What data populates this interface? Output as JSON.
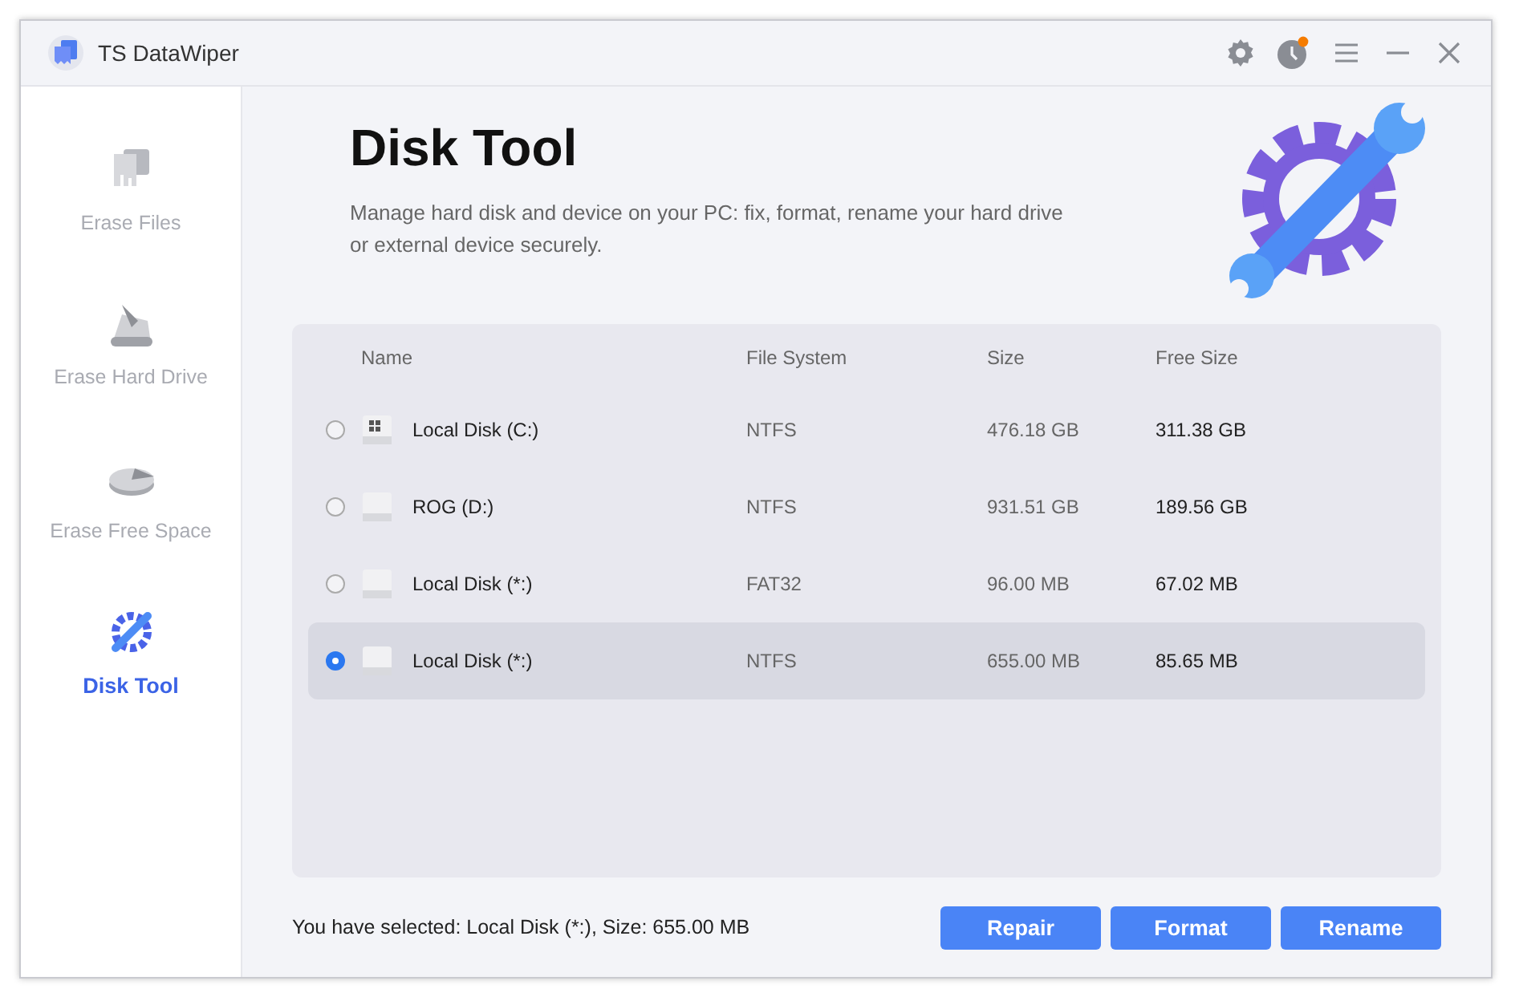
{
  "window": {
    "title": "TS DataWiper",
    "notification": true
  },
  "sidebar": {
    "items": [
      {
        "label": "Erase Files",
        "kind": "files",
        "selected": false
      },
      {
        "label": "Erase Hard Drive",
        "kind": "drive",
        "selected": false
      },
      {
        "label": "Erase Free Space",
        "kind": "space",
        "selected": false
      },
      {
        "label": "Disk Tool",
        "kind": "tool",
        "selected": true
      }
    ]
  },
  "header": {
    "title": "Disk Tool",
    "description": "Manage hard disk and device on your PC: fix, format, rename your hard drive or external device securely."
  },
  "table": {
    "columns": [
      "Name",
      "File System",
      "Size",
      "Free Size"
    ],
    "rows": [
      {
        "kind": "system",
        "name": "Local Disk (C:)",
        "file_system": "NTFS",
        "size": "476.18 GB",
        "free_size": "311.38 GB",
        "selected": false
      },
      {
        "kind": "disk",
        "name": "ROG (D:)",
        "file_system": "NTFS",
        "size": "931.51 GB",
        "free_size": "189.56 GB",
        "selected": false
      },
      {
        "kind": "disk",
        "name": "Local Disk (*:)",
        "file_system": "FAT32",
        "size": "96.00 MB",
        "free_size": "67.02 MB",
        "selected": false
      },
      {
        "kind": "disk",
        "name": "Local Disk (*:)",
        "file_system": "NTFS",
        "size": "655.00 MB",
        "free_size": "85.65 MB",
        "selected": true
      }
    ]
  },
  "status": "You have selected: Local Disk (*:), Size: 655.00 MB",
  "buttons": [
    "Repair",
    "Format",
    "Rename"
  ]
}
